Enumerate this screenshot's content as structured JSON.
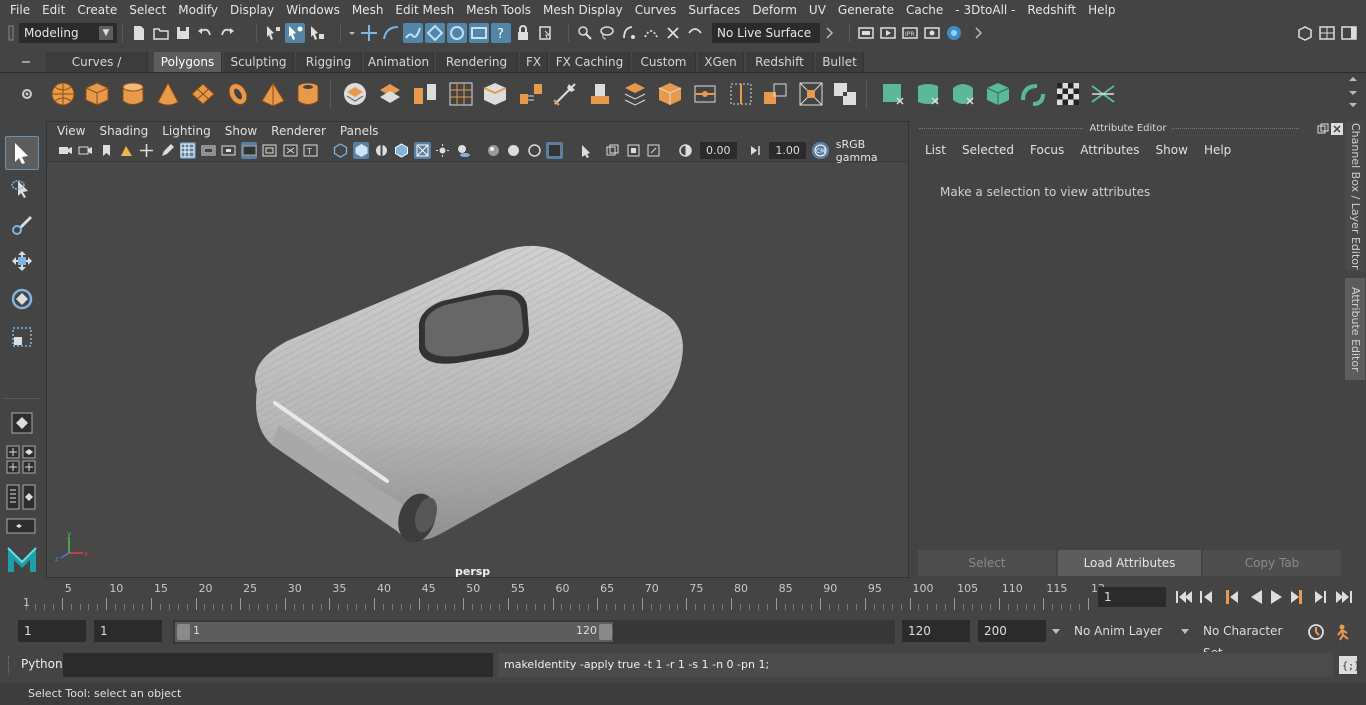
{
  "menubar": [
    "File",
    "Edit",
    "Create",
    "Select",
    "Modify",
    "Display",
    "Windows",
    "Mesh",
    "Edit Mesh",
    "Mesh Tools",
    "Mesh Display",
    "Curves",
    "Surfaces",
    "Deform",
    "UV",
    "Generate",
    "Cache",
    "- 3DtoAll -",
    "Redshift",
    "Help"
  ],
  "statusline": {
    "mode": "Modeling",
    "live_surface": "No Live Surface"
  },
  "shelf_tabs": [
    "Curves / Surfaces",
    "Polygons",
    "Sculpting",
    "Rigging",
    "Animation",
    "Rendering",
    "FX",
    "FX Caching",
    "Custom",
    "XGen",
    "Redshift",
    "Bullet"
  ],
  "active_shelf_tab": "Polygons",
  "viewport": {
    "menu": [
      "View",
      "Shading",
      "Lighting",
      "Show",
      "Renderer",
      "Panels"
    ],
    "exposure": "0.00",
    "gamma": "1.00",
    "color_space": "sRGB gamma",
    "camera": "persp"
  },
  "attribute_editor": {
    "title": "Attribute Editor",
    "menu": [
      "List",
      "Selected",
      "Focus",
      "Attributes",
      "Show",
      "Help"
    ],
    "message": "Make a selection to view attributes",
    "buttons": [
      "Select",
      "Load Attributes",
      "Copy Tab"
    ]
  },
  "side_tabs": [
    "Channel Box / Layer Editor",
    "Attribute Editor"
  ],
  "timeline": {
    "ticks": [
      "5",
      "10",
      "15",
      "20",
      "25",
      "30",
      "35",
      "40",
      "45",
      "50",
      "55",
      "60",
      "65",
      "70",
      "75",
      "80",
      "85",
      "90",
      "95",
      "100",
      "105",
      "110",
      "115",
      "12"
    ],
    "start_label": "1",
    "current_frame": "1"
  },
  "range": {
    "start": "1",
    "playback_start": "1",
    "slider_start": "1",
    "slider_end": "120",
    "playback_end": "120",
    "end": "200",
    "anim_layer": "No Anim Layer",
    "character_set": "No Character Set"
  },
  "command": {
    "language": "Python",
    "result": "makeIdentity -apply true -t 1 -r 1 -s 1 -n 0 -pn 1;"
  },
  "help_line": "Select Tool: select an object",
  "colors": {
    "accent_blue": "#5285a6",
    "icon_orange": "#e89a4c",
    "icon_teal": "#5bb89a"
  }
}
